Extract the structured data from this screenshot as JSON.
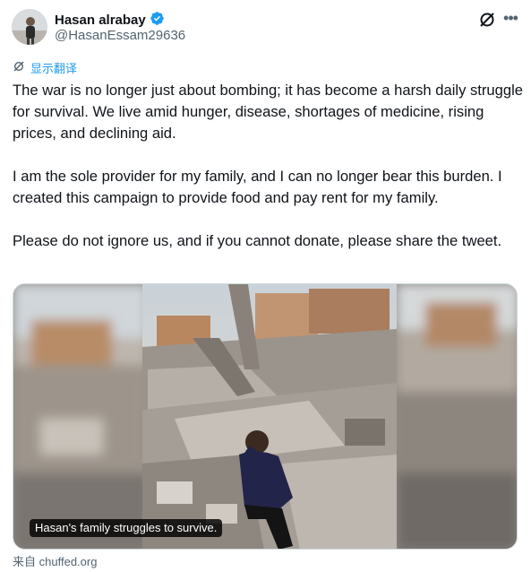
{
  "user": {
    "name": "Hasan alrabay",
    "handle": "@HasanEssam29636",
    "verified": true,
    "verified_color": "#1d9bf0"
  },
  "header_icons": [
    "grok-icon",
    "more-icon"
  ],
  "translate": {
    "label": "显示翻译",
    "icon": "translate-icon",
    "color": "#1d9bf0"
  },
  "tweet": {
    "paragraphs": [
      "The war is no longer just about bombing; it has become a harsh daily struggle for survival. We live amid hunger, disease, shortages of medicine, rising prices, and declining aid.",
      "I am the sole provider for my family, and I can no longer bear this burden. I created this campaign to provide food and pay rent for my family.",
      "Please do not ignore us, and if you cannot donate, please share the tweet."
    ]
  },
  "media": {
    "caption": "Hasan's family struggles to survive."
  },
  "source": {
    "prefix": "来自",
    "domain": "chuffed.org"
  }
}
